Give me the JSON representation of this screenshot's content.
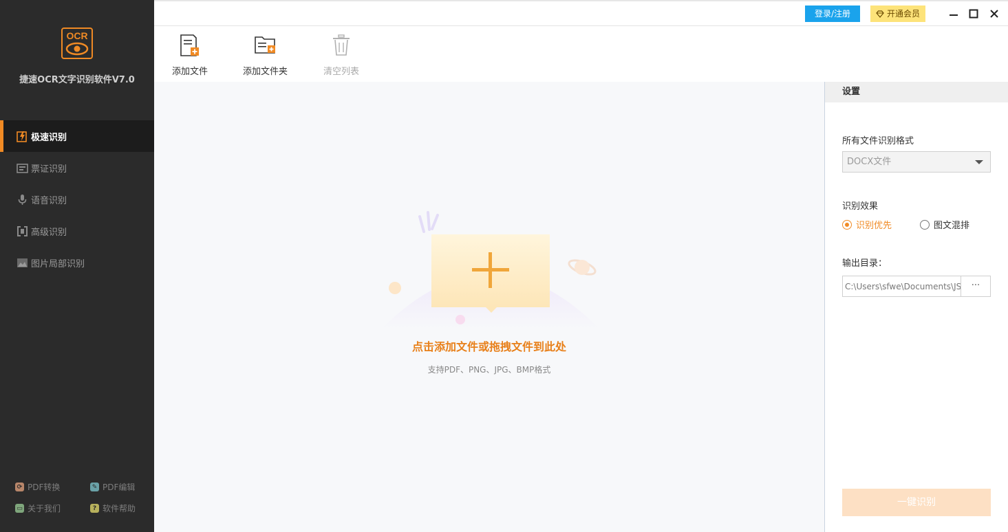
{
  "app": {
    "title": "捷速OCR文字识别软件V7.0",
    "logo_text": "OCR",
    "accent_color": "#f08a24"
  },
  "sidebar": {
    "items": [
      {
        "label": "极速识别",
        "icon": "lightning-doc-icon",
        "active": true
      },
      {
        "label": "票证识别",
        "icon": "ticket-icon",
        "active": false
      },
      {
        "label": "语音识别",
        "icon": "microphone-icon",
        "active": false
      },
      {
        "label": "高级识别",
        "icon": "advanced-scan-icon",
        "active": false
      },
      {
        "label": "图片局部识别",
        "icon": "image-crop-icon",
        "active": false
      }
    ],
    "footer": [
      {
        "label": "PDF转换",
        "icon": "pdf-convert-icon"
      },
      {
        "label": "PDF编辑",
        "icon": "pdf-edit-icon"
      },
      {
        "label": "关于我们",
        "icon": "about-icon"
      },
      {
        "label": "软件帮助",
        "icon": "help-icon"
      }
    ]
  },
  "titlebar": {
    "login_label": "登录/注册",
    "vip_label": "开通会员"
  },
  "toolbar": {
    "add_file": "添加文件",
    "add_folder": "添加文件夹",
    "clear_list": "清空列表"
  },
  "droparea": {
    "title": "点击添加文件或拖拽文件到此处",
    "subtitle": "支持PDF、PNG、JPG、BMP格式"
  },
  "settings": {
    "header": "设置",
    "format_label": "所有文件识别格式",
    "format_value": "DOCX文件",
    "effect_label": "识别效果",
    "effect_options": [
      {
        "label": "识别优先",
        "checked": true
      },
      {
        "label": "图文混排",
        "checked": false
      }
    ],
    "output_label": "输出目录：",
    "output_path": "C:\\Users\\sfwe\\Documents\\JS",
    "browse_label": "···",
    "run_label": "一键识别"
  }
}
